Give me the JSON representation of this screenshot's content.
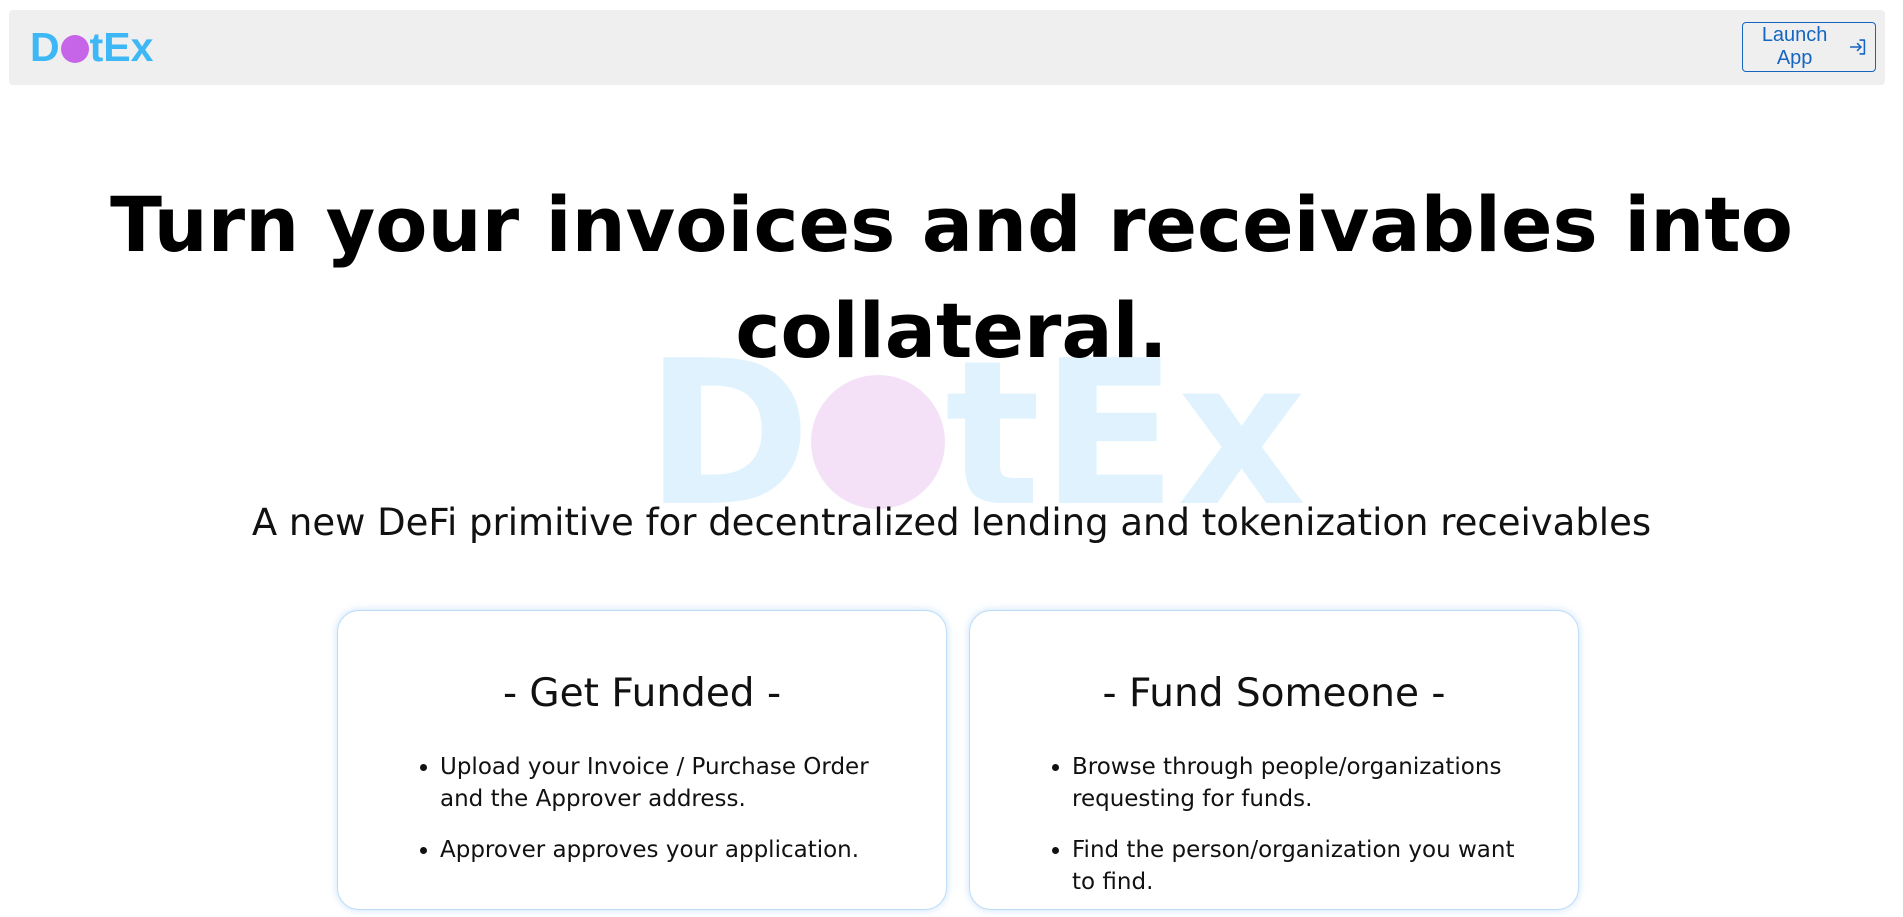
{
  "navbar": {
    "brand": {
      "prefix": "D",
      "suffix": "tEx"
    },
    "launch_button": {
      "label": "Launch App",
      "icon": "sign-in-icon"
    }
  },
  "hero": {
    "title": "Turn your invoices and receivables into collateral.",
    "watermark": {
      "prefix": "D",
      "suffix": "tEx"
    },
    "subtitle": "A new DeFi primitive for decentralized lending and tokenization receivables"
  },
  "cards": [
    {
      "title": "- Get Funded -",
      "items": [
        "Upload your Invoice / Purchase Order and the Approver address.",
        "Approver approves your application."
      ]
    },
    {
      "title": "- Fund Someone -",
      "items": [
        "Browse through people/organizations requesting for funds.",
        "Find the person/organization you want to find."
      ]
    }
  ],
  "colors": {
    "brand_blue": "#3db7f5",
    "brand_purple": "#c765e9",
    "button_blue": "#1565c0",
    "navbar_bg": "#efefef"
  }
}
